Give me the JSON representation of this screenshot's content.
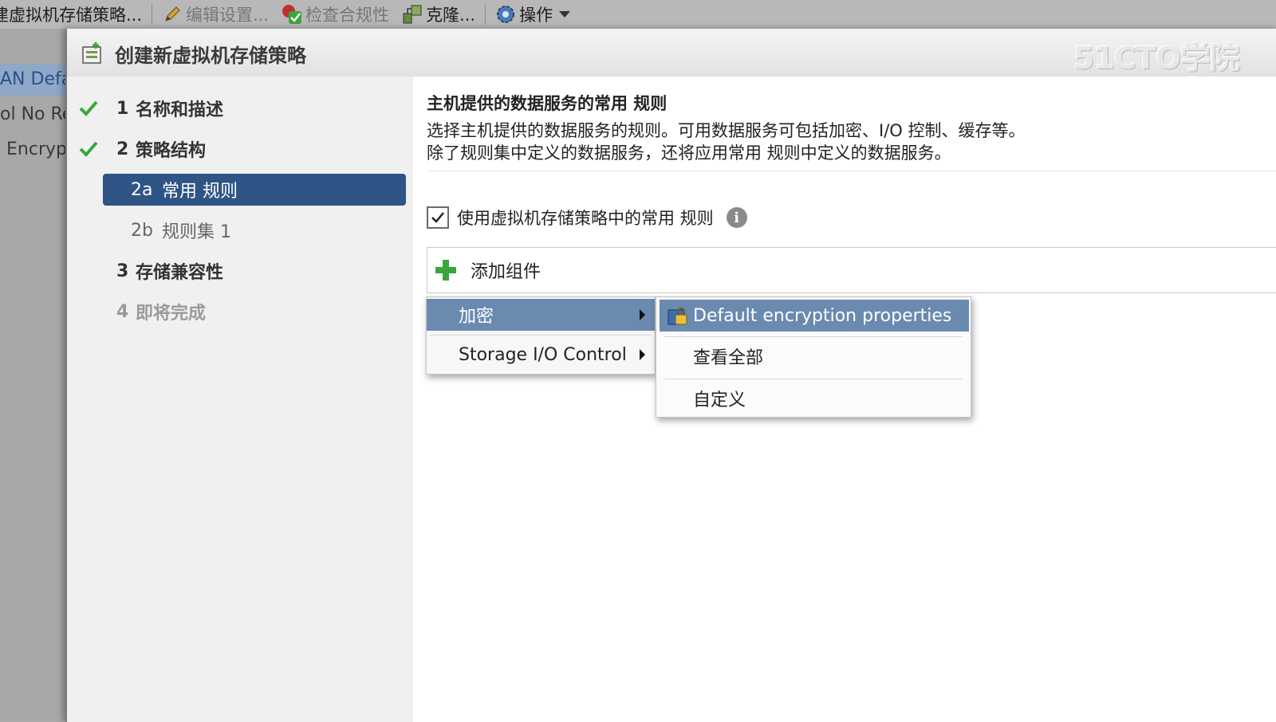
{
  "toolbar": {
    "item1": "建虚拟机存储策略...",
    "item2": "编辑设置...",
    "item3": "检查合规性",
    "item4": "克隆...",
    "item5": "操作",
    "icons": [
      "pencil-icon",
      "compliance-check-icon",
      "clone-icon",
      "gear-icon",
      "chevron-down-icon"
    ]
  },
  "bg_list": [
    "AN Defa",
    "ol No Re",
    "Encryp"
  ],
  "dialog": {
    "title": "创建新虚拟机存储策略",
    "watermark": "51CTO学院"
  },
  "wizard": {
    "steps": [
      {
        "num": "1",
        "label": "名称和描述",
        "state": "done"
      },
      {
        "num": "2",
        "label": "策略结构",
        "state": "done"
      }
    ],
    "substeps": [
      {
        "num": "2a",
        "label": "常用 规则",
        "state": "active"
      },
      {
        "num": "2b",
        "label": "规则集 1",
        "state": "inactive"
      }
    ],
    "later_steps": [
      {
        "num": "3",
        "label": "存储兼容性",
        "state": "done"
      },
      {
        "num": "4",
        "label": "即将完成",
        "state": "future"
      }
    ]
  },
  "main": {
    "section_title": "主机提供的数据服务的常用 规则",
    "desc_line1": "选择主机提供的数据服务的规则。可用数据服务可包括加密、I/O 控制、缓存等。",
    "desc_line2": "除了规则集中定义的数据服务，还将应用常用 规则中定义的数据服务。",
    "checkbox_label": "使用虚拟机存储策略中的常用 规则",
    "checkbox_checked": true,
    "add_component": "添加组件"
  },
  "menu": {
    "items": [
      {
        "label": "加密",
        "highlighted": true
      },
      {
        "label": "Storage I/O Control",
        "highlighted": false
      }
    ],
    "submenu": [
      {
        "label": "Default encryption properties",
        "highlighted": true
      },
      {
        "label": "查看全部",
        "highlighted": false
      },
      {
        "label": "自定义",
        "highlighted": false
      }
    ]
  },
  "colors": {
    "accent": "#2f5486",
    "menu_highlight": "#6a8ab0",
    "check_green": "#3aa63a"
  }
}
